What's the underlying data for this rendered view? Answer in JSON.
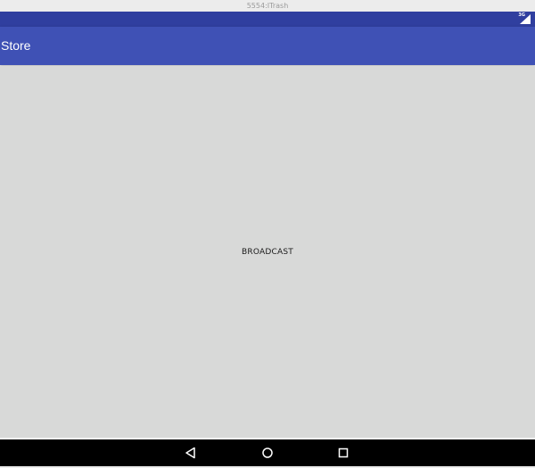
{
  "window": {
    "title": "5554:ITrash"
  },
  "status_bar": {
    "network_type": "3G",
    "icon": "signal-icon",
    "color": "#303f9f"
  },
  "app_bar": {
    "title": "Store",
    "color": "#3f51b5"
  },
  "main": {
    "broadcast_label": "BROADCAST",
    "background": "#d8d9d8"
  },
  "navigation": {
    "buttons": [
      {
        "icon": "back-icon"
      },
      {
        "icon": "home-icon"
      },
      {
        "icon": "recents-icon"
      }
    ]
  }
}
